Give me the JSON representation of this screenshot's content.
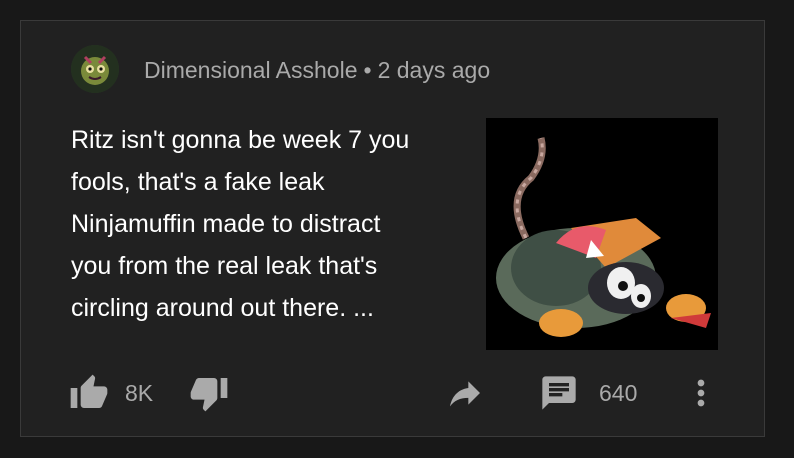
{
  "post": {
    "author": "Dimensional Asshole",
    "separator": "•",
    "time": "2 days ago",
    "body_lines": [
      "Ritz isn't gonna be week 7 you",
      "fools, that's a fake leak",
      "Ninjamuffin made to distract",
      "you from the real leak that's",
      "circling around out there. ..."
    ]
  },
  "actions": {
    "like_count": "8K",
    "comment_count": "640",
    "icons": [
      "thumb-up-icon",
      "thumb-down-icon",
      "share-icon",
      "comment-icon",
      "more-vert-icon"
    ]
  },
  "colors": {
    "page_bg": "#181818",
    "card_bg": "#212121",
    "card_border": "#3a3a3a",
    "text_primary": "#ffffff",
    "text_secondary": "#aaaaaa"
  }
}
